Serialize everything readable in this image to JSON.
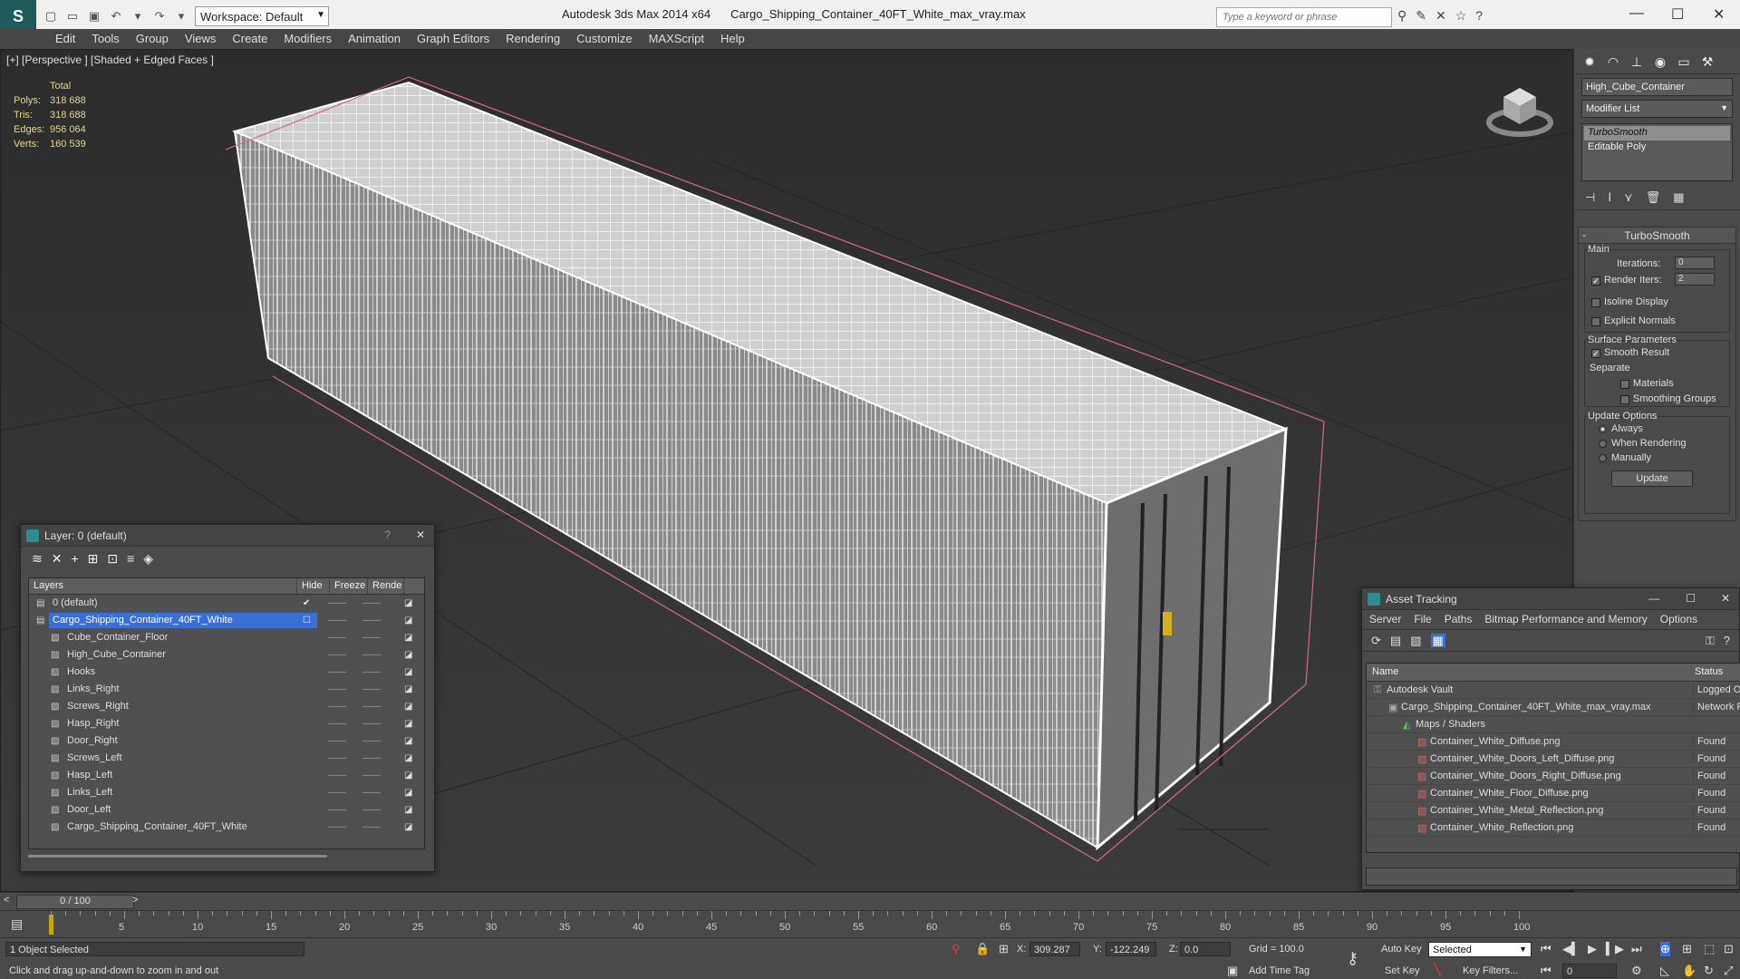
{
  "titlebar": {
    "workspace": "Workspace: Default",
    "app_title": "Autodesk 3ds Max  2014 x64",
    "file_title": "Cargo_Shipping_Container_40FT_White_max_vray.max",
    "search_placeholder": "Type a keyword or phrase"
  },
  "menu": [
    "Edit",
    "Tools",
    "Group",
    "Views",
    "Create",
    "Modifiers",
    "Animation",
    "Graph Editors",
    "Rendering",
    "Customize",
    "MAXScript",
    "Help"
  ],
  "viewport": {
    "label": "[+] [Perspective ] [Shaded + Edged Faces ]",
    "stats": {
      "header": "Total",
      "rows": [
        {
          "k": "Polys:",
          "v": "318 688"
        },
        {
          "k": "Tris:",
          "v": "318 688"
        },
        {
          "k": "Edges:",
          "v": "956 064"
        },
        {
          "k": "Verts:",
          "v": "160 539"
        }
      ]
    }
  },
  "command_panel": {
    "object_name": "High_Cube_Container",
    "modifier_list": "Modifier List",
    "stack": [
      "TurboSmooth",
      "Editable Poly"
    ],
    "rollout_title": "TurboSmooth",
    "main_group": "Main",
    "iterations_label": "Iterations:",
    "iterations_value": "0",
    "render_iters_label": "Render Iters:",
    "render_iters_value": "2",
    "isoline": "Isoline Display",
    "explicit_normals": "Explicit Normals",
    "surface_params": "Surface Parameters",
    "smooth_result": "Smooth Result",
    "separate": "Separate",
    "materials": "Materials",
    "smoothing_groups": "Smoothing Groups",
    "update_options": "Update Options",
    "always": "Always",
    "when_rendering": "When Rendering",
    "manually": "Manually",
    "update_button": "Update"
  },
  "layer_panel": {
    "title": "Layer: 0 (default)",
    "columns": [
      "Layers",
      "Hide",
      "Freeze",
      "Rende"
    ],
    "rows": [
      "0 (default)",
      "Cargo_Shipping_Container_40FT_White",
      "Cube_Container_Floor",
      "High_Cube_Container",
      "Hooks",
      "Links_Right",
      "Screws_Right",
      "Hasp_Right",
      "Door_Right",
      "Screws_Left",
      "Hasp_Left",
      "Links_Left",
      "Door_Left",
      "Cargo_Shipping_Container_40FT_White"
    ]
  },
  "asset_panel": {
    "title": "Asset Tracking",
    "menu": [
      "Server",
      "File",
      "Paths",
      "Bitmap Performance and Memory",
      "Options"
    ],
    "columns": [
      "Name",
      "Status"
    ],
    "rows": [
      {
        "name": "Autodesk Vault",
        "status": "Logged O"
      },
      {
        "name": "Cargo_Shipping_Container_40FT_White_max_vray.max",
        "status": "Network P"
      },
      {
        "name": "Maps / Shaders",
        "status": ""
      },
      {
        "name": "Container_White_Diffuse.png",
        "status": "Found"
      },
      {
        "name": "Container_White_Doors_Left_Diffuse.png",
        "status": "Found"
      },
      {
        "name": "Container_White_Doors_Right_Diffuse.png",
        "status": "Found"
      },
      {
        "name": "Container_White_Floor_Diffuse.png",
        "status": "Found"
      },
      {
        "name": "Container_White_Metal_Reflection.png",
        "status": "Found"
      },
      {
        "name": "Container_White_Reflection.png",
        "status": "Found"
      }
    ]
  },
  "timeline": {
    "frame": "0 / 100",
    "ticks": [
      "0",
      "5",
      "10",
      "15",
      "20",
      "25",
      "30",
      "35",
      "40",
      "45",
      "50",
      "55",
      "60",
      "65",
      "70",
      "75",
      "80",
      "85",
      "90",
      "95",
      "100"
    ]
  },
  "status": {
    "selection": "1 Object Selected",
    "prompt": "Click and drag up-and-down to zoom in and out",
    "x_label": "X:",
    "x_value": "309.287",
    "y_label": "Y:",
    "y_value": "-122.249",
    "z_label": "Z:",
    "z_value": "0.0",
    "grid": "Grid = 100.0",
    "add_time_tag": "Add Time Tag",
    "auto_key": "Auto Key",
    "set_key": "Set Key",
    "selected": "Selected",
    "key_filters": "Key Filters...",
    "frame_value": "0"
  }
}
